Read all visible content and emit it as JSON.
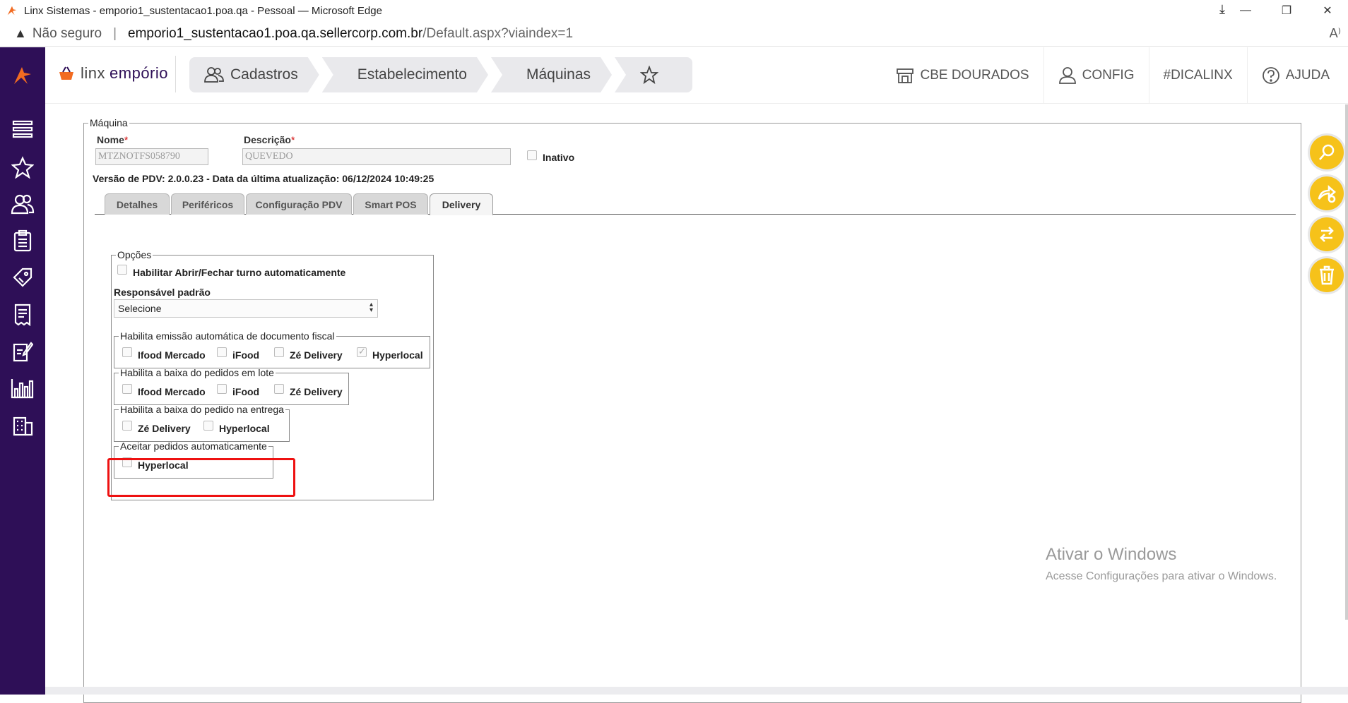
{
  "window": {
    "title": "Linx Sistemas - emporio1_sustentacao1.poa.qa - Pessoal — Microsoft Edge",
    "minimize": "—",
    "restore": "❐",
    "close": "✕"
  },
  "address": {
    "security_label": "Não seguro",
    "host": "emporio1_sustentacao1.poa.qa.sellercorp.com.br",
    "path": "/Default.aspx?viaindex=1"
  },
  "brand": {
    "part1": "linx",
    "part2": "empório"
  },
  "breadcrumbs": [
    {
      "label": "Cadastros",
      "icon": "users-icon"
    },
    {
      "label": "Estabelecimento"
    },
    {
      "label": "Máquinas"
    },
    {
      "icon": "star-icon"
    }
  ],
  "topright": {
    "store_label": "CBE DOURADOS",
    "config_label": "CONFIG",
    "tip_label": "#DICALINX",
    "help_label": "AJUDA"
  },
  "sidebar": {
    "icons": [
      "linx-logo-icon",
      "menu-list-icon",
      "star-icon",
      "users-icon",
      "clipboard-icon",
      "tag-icon",
      "receipt-icon",
      "edit-document-icon",
      "bar-chart-icon",
      "building-icon"
    ]
  },
  "form": {
    "legend": "Máquina",
    "nome_label": "Nome",
    "nome_value": "MTZNOTFS058790",
    "descricao_label": "Descrição",
    "descricao_value": "QUEVEDO",
    "required_mark": "*",
    "inativo_label": "Inativo",
    "version_text": "Versão de PDV: 2.0.0.23 - Data da última atualização: 06/12/2024 10:49:25"
  },
  "tabs": [
    {
      "label": "Detalhes",
      "active": false
    },
    {
      "label": "Periféricos",
      "active": false
    },
    {
      "label": "Configuração PDV",
      "active": false
    },
    {
      "label": "Smart POS",
      "active": false
    },
    {
      "label": "Delivery",
      "active": true
    }
  ],
  "delivery": {
    "opcoes_legend": "Opções",
    "habilitar_turno_label": "Habilitar Abrir/Fechar turno automaticamente",
    "habilitar_turno_checked": false,
    "responsavel_label": "Responsável padrão",
    "responsavel_value": "Selecione",
    "emissao_legend": "Habilita emissão automática de documento fiscal",
    "emissao_options": [
      {
        "label": "Ifood Mercado",
        "checked": false
      },
      {
        "label": "iFood",
        "checked": false
      },
      {
        "label": "Zé Delivery",
        "checked": false
      },
      {
        "label": "Hyperlocal",
        "checked": true
      }
    ],
    "baixa_lote_legend": "Habilita a baixa do pedidos em lote",
    "baixa_lote_options": [
      {
        "label": "Ifood Mercado",
        "checked": false
      },
      {
        "label": "iFood",
        "checked": false
      },
      {
        "label": "Zé Delivery",
        "checked": false
      }
    ],
    "baixa_entrega_legend": "Habilita a baixa do pedido na entrega",
    "baixa_entrega_options": [
      {
        "label": "Zé Delivery",
        "checked": false
      },
      {
        "label": "Hyperlocal",
        "checked": false
      }
    ],
    "aceitar_legend": "Aceitar pedidos automaticamente",
    "aceitar_options": [
      {
        "label": "Hyperlocal",
        "checked": false
      }
    ]
  },
  "actions": [
    "search-icon",
    "forward-new-icon",
    "swap-icon",
    "trash-icon"
  ],
  "watermark": {
    "line1": "Ativar o Windows",
    "line2": "Acesse Configurações para ativar o Windows."
  },
  "colors": {
    "sidebar_bg": "#2e0f57",
    "accent_orange": "#f26b21",
    "fab_yellow": "#f6c21a",
    "highlight_red": "#ee1111"
  }
}
